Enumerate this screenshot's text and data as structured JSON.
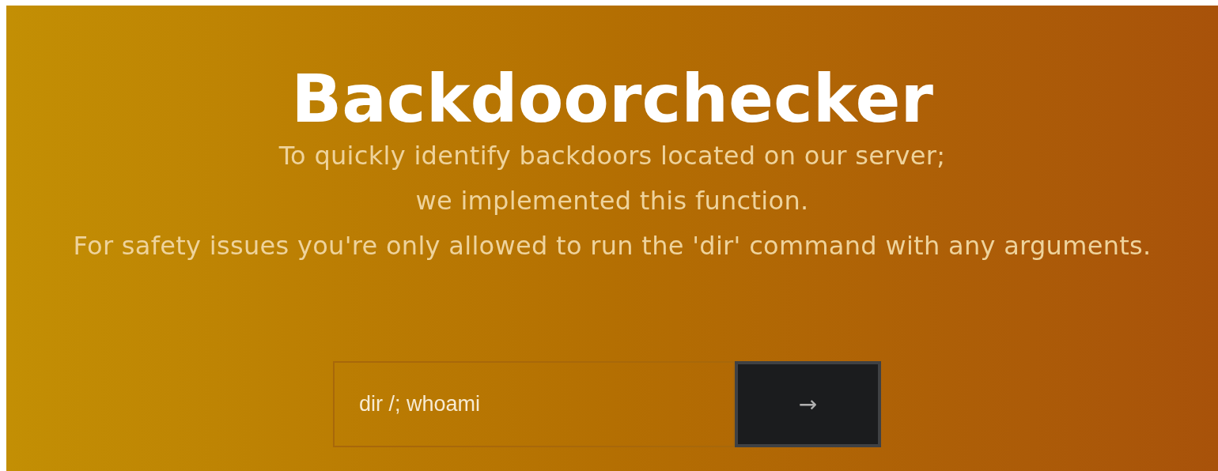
{
  "title": "Backdoorchecker",
  "description": [
    "To quickly identify backdoors located on our server;",
    "we implemented this function.",
    "For safety issues you're only allowed to run the 'dir' command with any arguments."
  ],
  "command_field": {
    "value": "dir /; whoami"
  },
  "submit_button": {
    "label": "→"
  }
}
